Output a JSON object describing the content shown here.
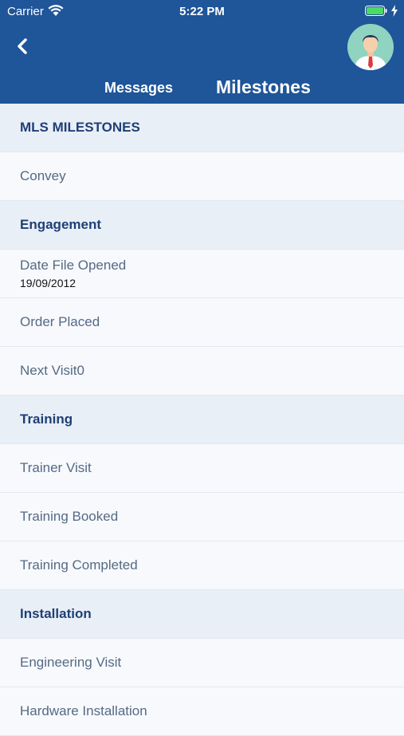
{
  "status_bar": {
    "carrier": "Carrier",
    "time": "5:22 PM"
  },
  "header": {
    "tabs": [
      {
        "label": "Messages",
        "active": false
      },
      {
        "label": "Milestones",
        "active": true
      }
    ],
    "back_icon": "chevron-left-icon",
    "avatar_icon": "user-avatar-icon",
    "background_color": "#1f5599"
  },
  "list": {
    "rows": [
      {
        "type": "section",
        "label": "MLS MILESTONES"
      },
      {
        "type": "item",
        "label": "Convey"
      },
      {
        "type": "section",
        "label": "Engagement"
      },
      {
        "type": "item",
        "label": "Date File Opened",
        "value": "19/09/2012"
      },
      {
        "type": "item",
        "label": "Order Placed"
      },
      {
        "type": "item",
        "label": "Next Visit0"
      },
      {
        "type": "section",
        "label": "Training"
      },
      {
        "type": "item",
        "label": "Trainer Visit"
      },
      {
        "type": "item",
        "label": "Training Booked"
      },
      {
        "type": "item",
        "label": "Training Completed"
      },
      {
        "type": "section",
        "label": "Installation"
      },
      {
        "type": "item",
        "label": "Engineering Visit"
      },
      {
        "type": "item",
        "label": "Hardware Installation"
      }
    ]
  }
}
